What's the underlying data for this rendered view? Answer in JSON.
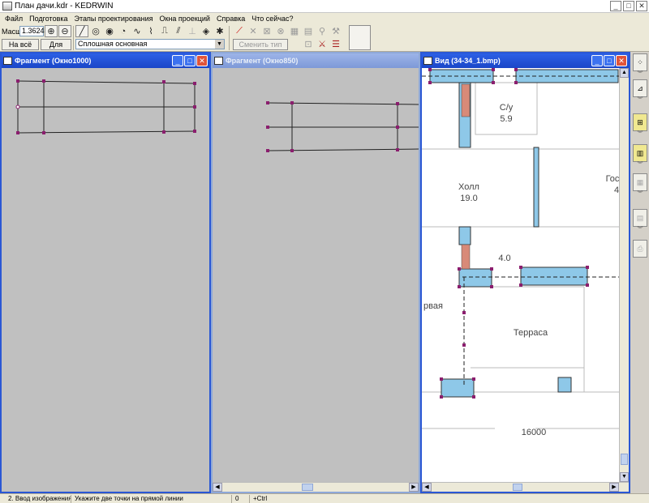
{
  "app": {
    "title": "План дачи.kdr - KEDRWIN"
  },
  "menu": [
    "Файл",
    "Подготовка",
    "Этапы проектирования",
    "Окна проекций",
    "Справка",
    "Что сейчас?"
  ],
  "toolbar": {
    "scale_label": "Масшт",
    "scale_value": "1.3624",
    "fit_all_label": "На всё окно",
    "for_all_label": "Для всех",
    "line_type": "Сплошная основная",
    "change_line_type_label": "Сменить тип линии",
    "icons": [
      "segment-icon",
      "circle-tangent-icon",
      "circle-three-point-icon",
      "arc-icon",
      "spline-icon",
      "curve-icon",
      "fillet-icon",
      "offset-icon",
      "dimension-icon",
      "snap-icon",
      "divide-icon"
    ],
    "edit_icons": [
      "trim-icon",
      "delete-segment-icon",
      "delete-icon",
      "delete-all-icon",
      "copy-icon",
      "move-icon",
      "rotate-icon",
      "mirror-icon",
      "measure-icon",
      "hatch-icon"
    ]
  },
  "windows": [
    {
      "title": "Фрагмент (Окно1000)",
      "state": "active"
    },
    {
      "title": "Фрагмент (Окно850)",
      "state": "inactive"
    },
    {
      "title": "Вид (34-34_1.bmp)",
      "state": "active"
    }
  ],
  "floorplan": {
    "rooms": [
      {
        "name": "С/у",
        "area": "5.9"
      },
      {
        "name": "Холл",
        "area": "19.0"
      },
      {
        "name": "Гос",
        "area": "4"
      },
      {
        "name": "",
        "area": "4.0"
      },
      {
        "name": "Терраса",
        "area": ""
      },
      {
        "name": "рвая",
        "area": ""
      }
    ],
    "dimension": "16000"
  },
  "status": {
    "mode": "2. Ввод изображения",
    "hint": "Укажите две точки на прямой линии",
    "value": "0",
    "modifier": "+Ctrl"
  },
  "colors": {
    "title_active": "#2a57d4",
    "wall_fill": "#8ec8e8",
    "marker": "#8b1e6e",
    "brick": "#d88a78"
  }
}
